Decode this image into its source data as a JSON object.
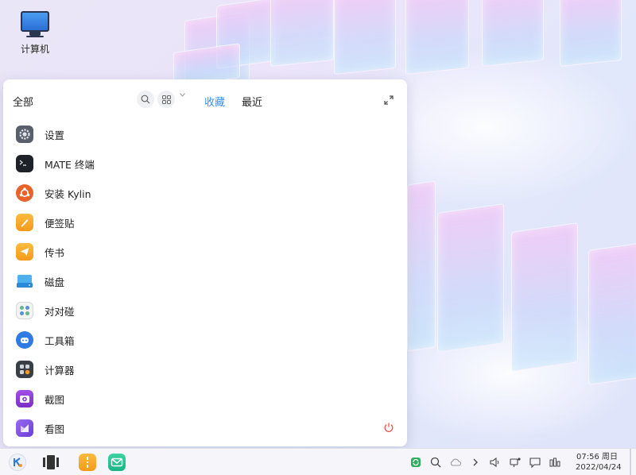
{
  "desktop": {
    "icons": [
      {
        "label": "计算机",
        "icon": "monitor-icon"
      }
    ]
  },
  "start_menu": {
    "title": "全部",
    "tabs": {
      "favorites": "收藏",
      "recent": "最近"
    },
    "apps": [
      {
        "label": "设置",
        "icon": "gear-icon",
        "color": "#5a5f6b"
      },
      {
        "label": "MATE 终端",
        "icon": "terminal-icon",
        "color": "#1e2228"
      },
      {
        "label": "安装 Kylin",
        "icon": "installer-icon",
        "color": "#e8632a"
      },
      {
        "label": "便签贴",
        "icon": "sticky-note-icon",
        "color": "#f7a42a"
      },
      {
        "label": "传书",
        "icon": "send-icon",
        "color": "#f7a42a"
      },
      {
        "label": "磁盘",
        "icon": "disk-icon",
        "color": "#3aa0e6"
      },
      {
        "label": "对对碰",
        "icon": "match-game-icon",
        "color": "#7fc8a0"
      },
      {
        "label": "工具箱",
        "icon": "toolbox-icon",
        "color": "#2f7be4"
      },
      {
        "label": "计算器",
        "icon": "calculator-icon",
        "color": "#3a3f47"
      },
      {
        "label": "截图",
        "icon": "screenshot-icon",
        "color": "#8b3fd4"
      },
      {
        "label": "看图",
        "icon": "image-viewer-icon",
        "color": "#7d4de0"
      }
    ]
  },
  "taskbar": {
    "clock_time": "07:56 周日",
    "clock_date": "2022/04/24",
    "accent": "#3790fa"
  }
}
